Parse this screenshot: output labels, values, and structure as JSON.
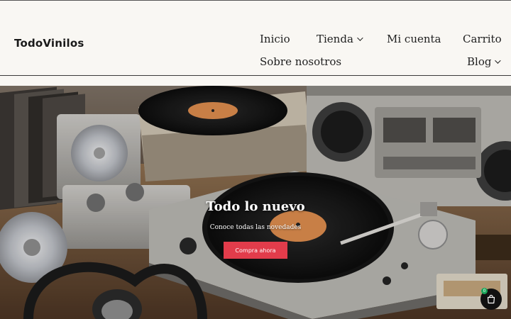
{
  "site": {
    "logo": "TodoVinilos"
  },
  "nav": {
    "items": [
      {
        "label": "Inicio"
      },
      {
        "label": "Tienda"
      },
      {
        "label": "Mi cuenta"
      },
      {
        "label": "Carrito"
      },
      {
        "label": "Sobre nosotros"
      },
      {
        "label": "Blog"
      }
    ]
  },
  "hero": {
    "title": "Todo lo nuevo",
    "subtitle": "Conoce todas las novedades",
    "button": "Compra ahora",
    "button_color": "#e23c4b"
  },
  "cart": {
    "count": "0",
    "icon": "shopping-bag-icon",
    "badge_color": "#1aa65a"
  }
}
